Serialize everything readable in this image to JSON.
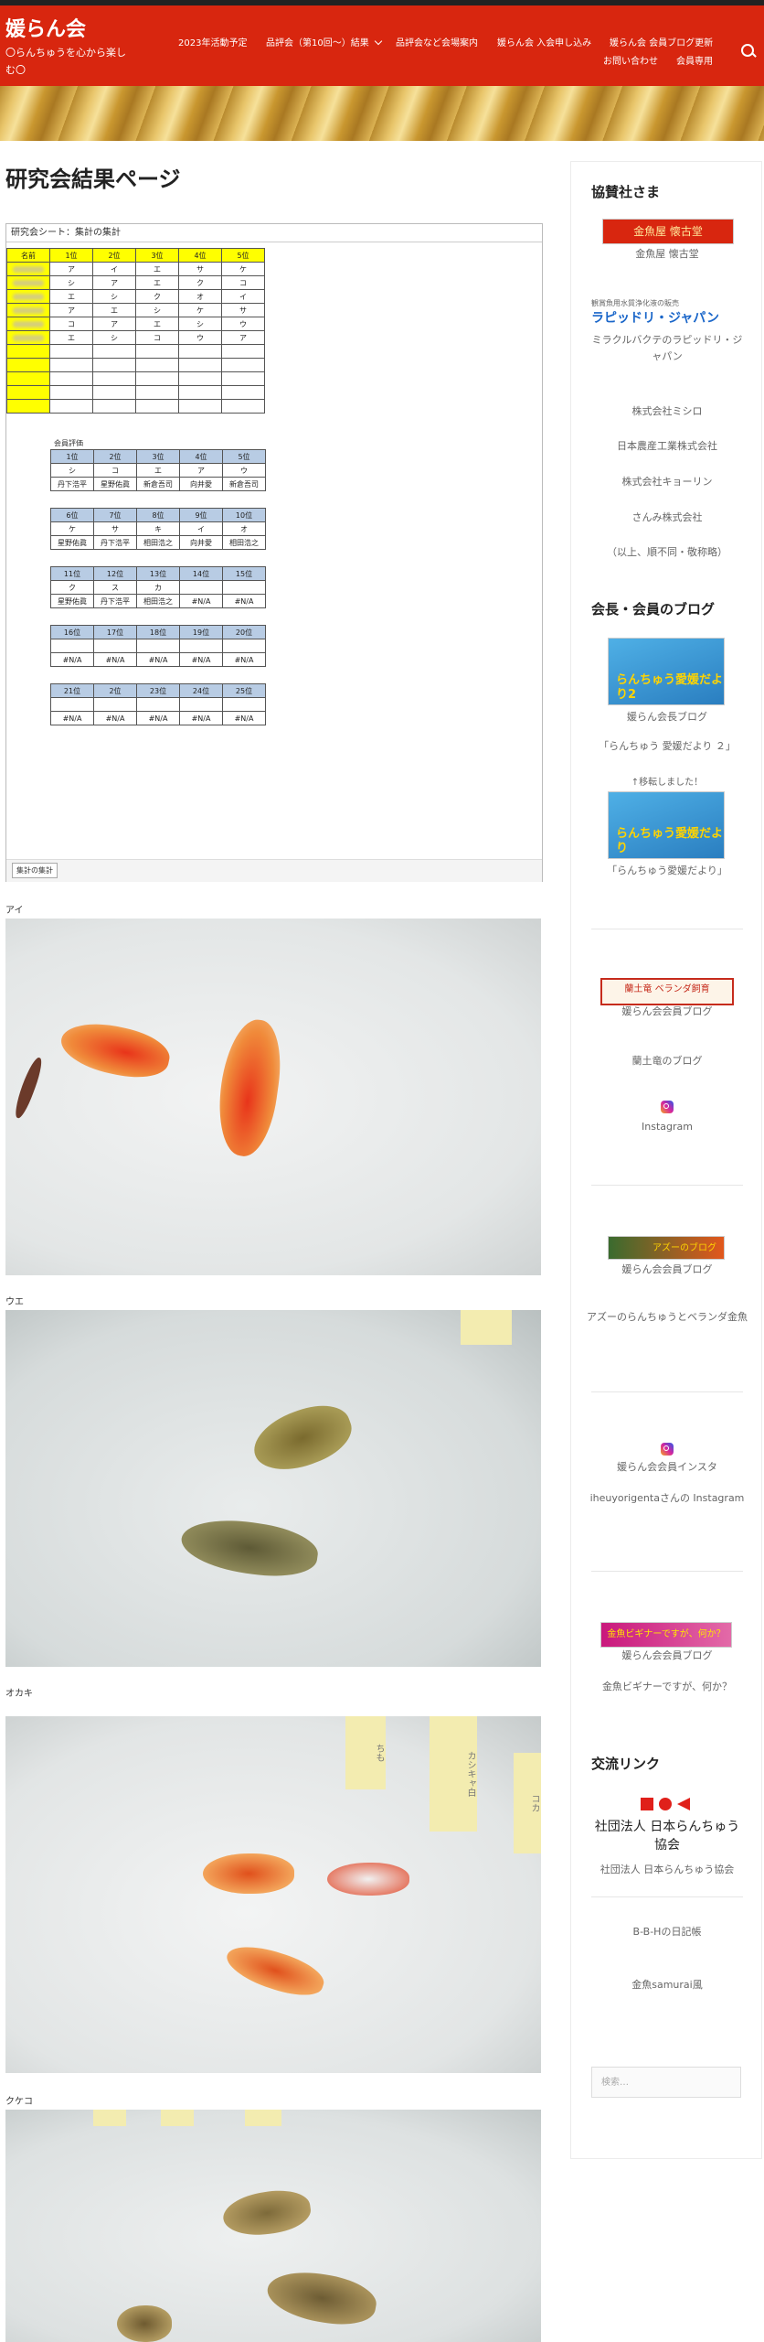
{
  "header": {
    "site_title": "媛らん会",
    "tagline": "〇らんちゅうを心から楽しむ〇",
    "nav": [
      "2023年活動予定",
      "品評会（第10回〜）結果",
      "品評会など会場案内",
      "媛らん会 入会申し込み",
      "媛らん会 会員ブログ更新",
      "お問い合わせ",
      "会員専用"
    ]
  },
  "main": {
    "title": "研究会結果ページ",
    "sheet": {
      "name": "研究会シート：集計の集計",
      "tab": "集計の集計",
      "grid_headers": [
        "名前",
        "1位",
        "2位",
        "3位",
        "4位",
        "5位"
      ],
      "grid_rows": [
        [
          "ア",
          "イ",
          "エ",
          "サ",
          "ケ"
        ],
        [
          "シ",
          "ア",
          "エ",
          "ク",
          "コ"
        ],
        [
          "エ",
          "シ",
          "ク",
          "オ",
          "イ"
        ],
        [
          "ア",
          "エ",
          "シ",
          "ケ",
          "サ"
        ],
        [
          "コ",
          "ア",
          "エ",
          "シ",
          "ウ"
        ],
        [
          "エ",
          "シ",
          "コ",
          "ウ",
          "ア"
        ]
      ],
      "eval_label": "会員評価",
      "results": [
        {
          "ranks": [
            "1位",
            "2位",
            "3位",
            "4位",
            "5位"
          ],
          "codes": [
            "シ",
            "コ",
            "エ",
            "ア",
            "ウ"
          ],
          "names": [
            "丹下浩平",
            "星野佑眞",
            "新倉吾司",
            "向井愛",
            "新倉吾司"
          ]
        },
        {
          "ranks": [
            "6位",
            "7位",
            "8位",
            "9位",
            "10位"
          ],
          "codes": [
            "ケ",
            "サ",
            "キ",
            "イ",
            "オ"
          ],
          "names": [
            "星野佑眞",
            "丹下浩平",
            "相田浩之",
            "向井愛",
            "相田浩之"
          ]
        },
        {
          "ranks": [
            "11位",
            "12位",
            "13位",
            "14位",
            "15位"
          ],
          "codes": [
            "ク",
            "ス",
            "カ",
            "",
            ""
          ],
          "names": [
            "星野佑眞",
            "丹下浩平",
            "相田浩之",
            "#N/A",
            "#N/A"
          ]
        },
        {
          "ranks": [
            "16位",
            "17位",
            "18位",
            "19位",
            "20位"
          ],
          "codes": [
            "",
            "",
            "",
            "",
            ""
          ],
          "names": [
            "#N/A",
            "#N/A",
            "#N/A",
            "#N/A",
            "#N/A"
          ]
        },
        {
          "ranks": [
            "21位",
            "2位",
            "23位",
            "24位",
            "25位"
          ],
          "codes": [
            "",
            "",
            "",
            "",
            ""
          ],
          "names": [
            "#N/A",
            "#N/A",
            "#N/A",
            "#N/A",
            "#N/A"
          ]
        }
      ]
    },
    "photos": [
      {
        "label": "アイ",
        "notes": []
      },
      {
        "label": "ウエ",
        "notes": []
      },
      {
        "label": "オカキ",
        "notes": [
          "ちも",
          "カシキャ白",
          "コカ"
        ]
      },
      {
        "label": "クケコ",
        "notes": []
      }
    ]
  },
  "sidebar": {
    "sponsors_title": "協賛社さま",
    "sponsor1_logo": "金魚屋 懐古堂",
    "sponsor1_caption": "金魚屋 懐古堂",
    "sponsor2_small": "観賞魚用水質浄化液の販売",
    "sponsor2_logo": "ラピッドリ・ジャパン",
    "sponsor2_caption": "ミラクルバクテのラピッドリ・ジャパン",
    "sponsors_text": [
      "株式会社ミシロ",
      "日本農産工業株式会社",
      "株式会社キョーリン",
      "さんみ株式会社",
      "（以上、順不同・敬称略）"
    ],
    "blogs_title": "会長・会員のブログ",
    "blog1_img_text": "らんちゅう愛媛だより2",
    "blog1_caption": "媛らん会長ブログ",
    "blog1_link": "「らんちゅう 愛媛だより ２」",
    "moved_text": "↑移転しました！",
    "blog2_img_text": "らんちゅう愛媛だより",
    "blog2_link": "「らんちゅう愛媛だより」",
    "blog3_img_text": "蘭土竜 ベランダ飼育",
    "blog3_caption": "媛らん会会員ブログ",
    "blog3_link": "蘭土竜のブログ",
    "instagram1": "Instagram",
    "blog4_img_text": "アズーのブログ",
    "blog4_caption": "媛らん会会員ブログ",
    "blog4_link": "アズーのらんちゅうとベランダ金魚",
    "insta2_caption": "媛らん会会員インスタ",
    "insta2_link": "iheuyorigentaさんの Instagram",
    "blog5_img_text": "金魚ビギナーですが、何か？",
    "blog5_caption": "媛らん会会員ブログ",
    "blog5_link": "金魚ビギナーですが、何か？",
    "links_title": "交流リンク",
    "assoc_logo": "社団法人 日本らんちゅう協会",
    "assoc_caption": "社団法人 日本らんちゅう協会",
    "link2": "B-B-Hの日記帳",
    "link3": "金魚samurai風",
    "search_placeholder": "検索…"
  },
  "colors": {
    "header_red": "#d8260f",
    "sheet_yellow": "#ffff00",
    "result_blue": "#b8cce4"
  }
}
